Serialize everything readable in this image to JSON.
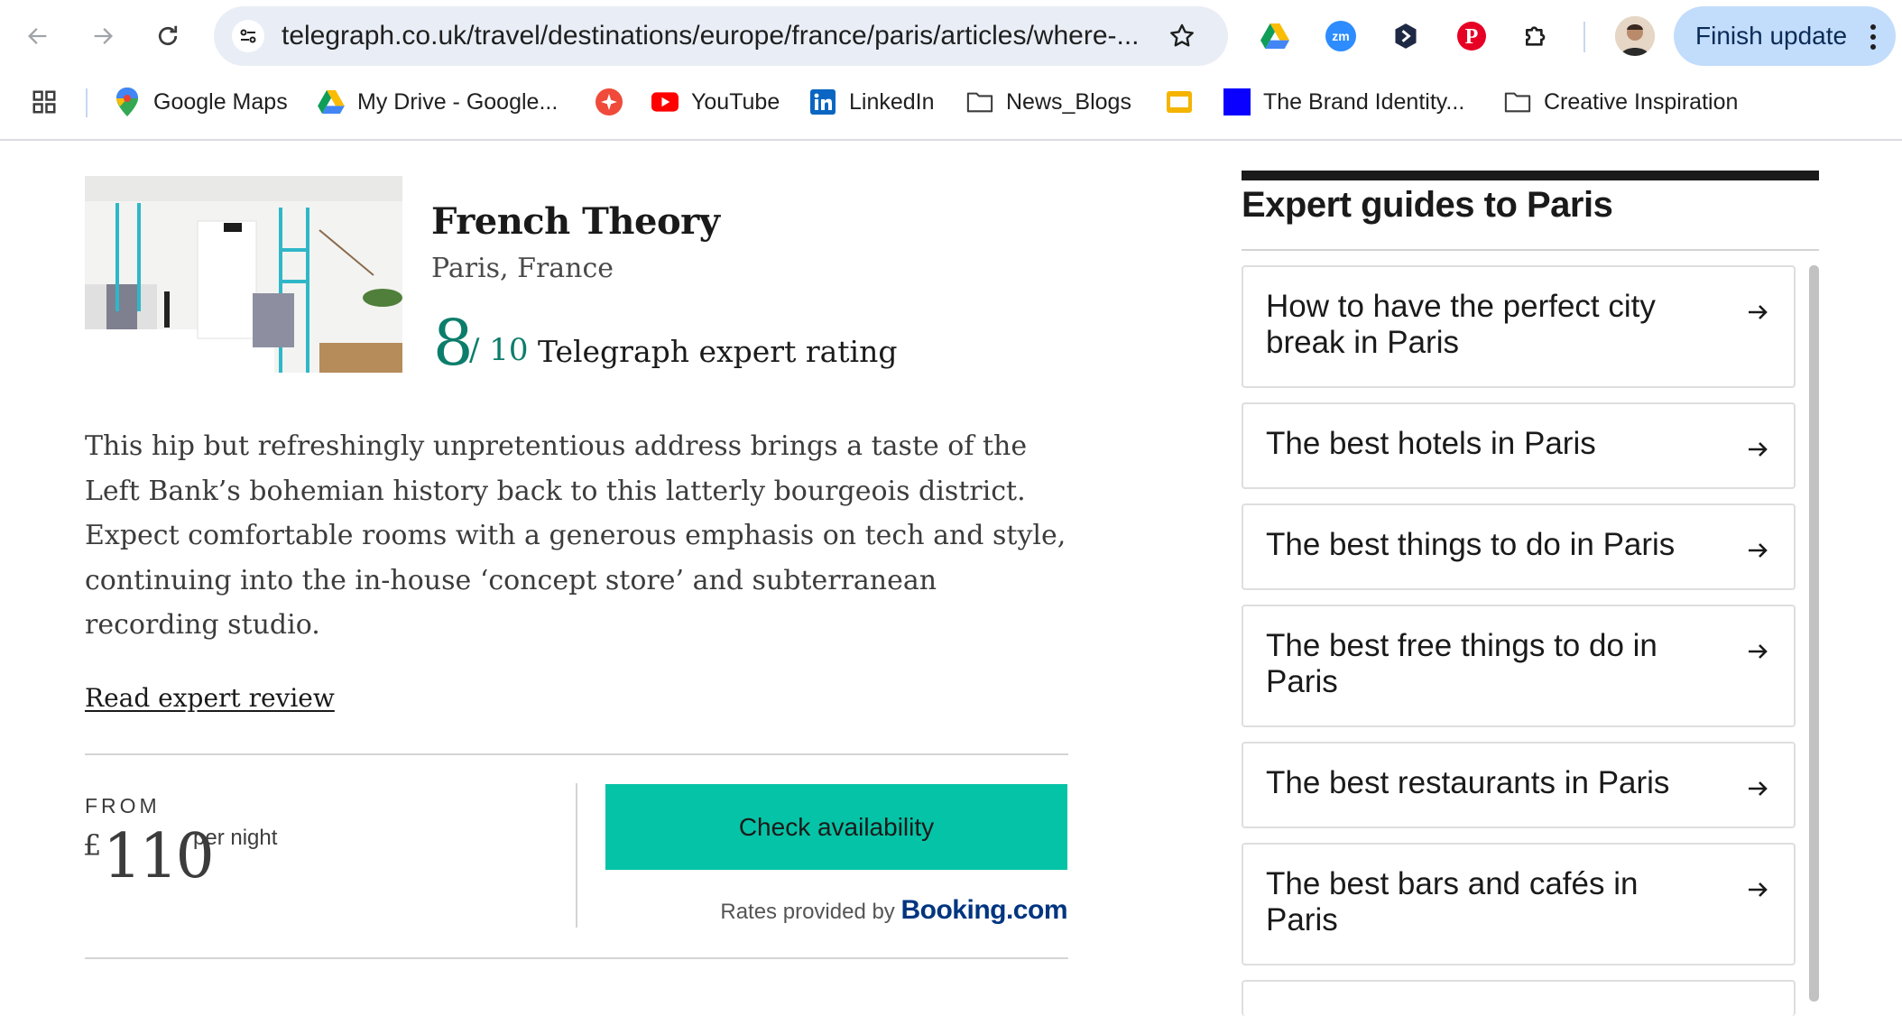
{
  "browser": {
    "url": "telegraph.co.uk/travel/destinations/europe/france/paris/articles/where-...",
    "finish_update_label": "Finish update",
    "extensions": [
      "google-drive-icon",
      "zoom-icon",
      "shield-extension-icon",
      "pinterest-icon",
      "puzzle-icon"
    ]
  },
  "bookmarks": [
    {
      "label": "Google Maps",
      "icon": "google-maps-icon"
    },
    {
      "label": "My Drive - Google...",
      "icon": "google-drive-icon"
    },
    {
      "label": "",
      "icon": "sparkle-icon"
    },
    {
      "label": "YouTube",
      "icon": "youtube-icon"
    },
    {
      "label": "LinkedIn",
      "icon": "linkedin-icon"
    },
    {
      "label": "News_Blogs",
      "icon": "folder-icon"
    },
    {
      "label": "",
      "icon": "slides-icon"
    },
    {
      "label": "The Brand Identity...",
      "icon": "blue-square-icon"
    },
    {
      "label": "Creative Inspiration",
      "icon": "folder-icon"
    }
  ],
  "hotel": {
    "name": "French Theory",
    "location": "Paris, France",
    "rating": "8",
    "rating_max": "/ 10",
    "rating_label": "Telegraph expert rating",
    "description": "This hip but refreshingly unpretentious address brings a taste of the Left Bank’s bohemian history back to this latterly bourgeois district. Expect comfortable rooms with a generous emphasis on tech and style, continuing into the in-house ‘concept store’ and subterranean recording studio.",
    "read_review": "Read expert review",
    "from_label": "FROM",
    "currency": "£",
    "price": "110",
    "price_unit": "per night",
    "check_button": "Check availability",
    "rates_label": "Rates provided by",
    "rates_brand": "Booking.com",
    "colors": {
      "accent": "#0c7d6b",
      "button": "#05c3a6",
      "booking": "#003580"
    }
  },
  "sidebar": {
    "title": "Expert guides to Paris",
    "guides": [
      {
        "label": "How to have the perfect city break in Paris"
      },
      {
        "label": "The best hotels in Paris"
      },
      {
        "label": "The best things to do in Paris"
      },
      {
        "label": "The best free things to do in Paris"
      },
      {
        "label": "The best restaurants in Paris"
      },
      {
        "label": "The best bars and cafés in Paris"
      }
    ]
  }
}
